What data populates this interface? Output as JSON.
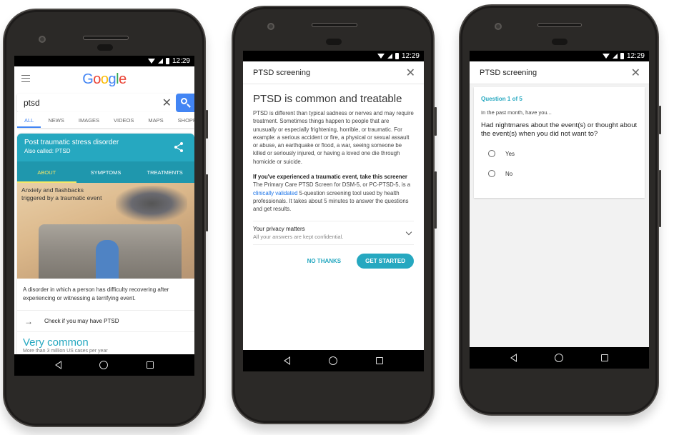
{
  "status_bar": {
    "time": "12:29"
  },
  "phone1": {
    "logo": "Google",
    "search": {
      "query": "ptsd",
      "clear_icon": "close-icon",
      "search_icon": "search-icon"
    },
    "tabs": [
      "ALL",
      "NEWS",
      "IMAGES",
      "VIDEOS",
      "MAPS",
      "SHOPPI"
    ],
    "active_tab": "ALL",
    "knowledge_panel": {
      "title": "Post traumatic stress disorder",
      "subtitle": "Also called: PTSD",
      "tabs": [
        "ABOUT",
        "SYMPTOMS",
        "TREATMENTS"
      ],
      "active_tab": "ABOUT",
      "image_caption_line1": "Anxiety and flashbacks",
      "image_caption_line2": "triggered by a traumatic event",
      "description": "A disorder in which a person has difficulty recovering after experiencing or witnessing a terrifying event.",
      "check_link": "Check if you may have PTSD",
      "stat_title": "Very common",
      "stat_sub": "More than 3 million US cases per year"
    }
  },
  "phone2": {
    "dialog_title": "PTSD screening",
    "heading": "PTSD is common and treatable",
    "paragraph1": "PTSD is different than typical sadness or nerves and may require treatment. Sometimes things happen to people that are unusually or especially frightening, horrible, or traumatic. For example: a serious accident or fire, a physical or sexual assault or abuse, an earthquake or flood, a war, seeing someone be killed or seriously injured, or having a loved one die through homicide or suicide.",
    "paragraph2_bold": "If you've experienced a traumatic event, take this screener",
    "paragraph2_a": "The Primary Care PTSD Screen for DSM-5, or PC-PTSD-5, is a ",
    "paragraph2_link": "clinically validated",
    "paragraph2_b": " 5-question screening tool used by health professionals. It takes about 5 minutes to answer the questions and get results.",
    "privacy_title": "Your privacy matters",
    "privacy_sub": "All your answers are kept confidential.",
    "no_thanks": "NO THANKS",
    "get_started": "GET STARTED"
  },
  "phone3": {
    "dialog_title": "PTSD screening",
    "question_number": "Question 1 of 5",
    "preface": "In the past month, have you...",
    "question": "Had nightmares about the event(s) or thought about the event(s) when you did not want to?",
    "options": [
      "Yes",
      "No"
    ]
  }
}
